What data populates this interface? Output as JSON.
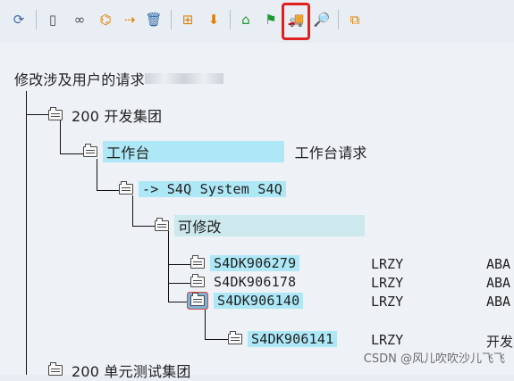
{
  "toolbar": {
    "icons": [
      {
        "name": "refresh-icon",
        "glyph": "⟳",
        "color": "#3b6aa6"
      },
      {
        "name": "new-document-icon",
        "glyph": "▯",
        "color": "#4c4c4c"
      },
      {
        "name": "glasses-icon",
        "glyph": "∞",
        "color": "#4c4c4c"
      },
      {
        "name": "hierarchy-icon",
        "glyph": "⌬",
        "color": "#e08000"
      },
      {
        "name": "forward-arrow-icon",
        "glyph": "⇢",
        "color": "#e08000"
      },
      {
        "name": "trash-icon",
        "glyph": "🗑",
        "color": "#2f68a6"
      },
      {
        "name": "structure-icon",
        "glyph": "⊞",
        "color": "#e08000"
      },
      {
        "name": "release-icon",
        "glyph": "⬇",
        "color": "#e08000"
      },
      {
        "name": "tree-icon",
        "glyph": "⌂",
        "color": "#1d9a31"
      },
      {
        "name": "flag-icon",
        "glyph": "⚑",
        "color": "#1d9a31"
      },
      {
        "name": "truck-icon",
        "glyph": "🚚",
        "color": "#e08000"
      },
      {
        "name": "search-doc-icon",
        "glyph": "🔎",
        "color": "#4c4c4c"
      },
      {
        "name": "copy-icon",
        "glyph": "⧉",
        "color": "#e08000"
      }
    ]
  },
  "tree": {
    "root_label": "修改涉及用户的请求",
    "nodes": {
      "client_200": {
        "label": "200 开发集团"
      },
      "workbench": {
        "label": "工作台",
        "desc": "工作台请求"
      },
      "system": {
        "label": "-> S4Q System S4Q"
      },
      "modifiable": {
        "label": "可修改"
      },
      "req1": {
        "id": "S4DK906279",
        "owner": "LRZY",
        "desc": "ABA"
      },
      "req2": {
        "id": "S4DK906178",
        "owner": "LRZY",
        "desc": "ABA"
      },
      "req3": {
        "id": "S4DK906140",
        "owner": "LRZY",
        "desc": "ABA"
      },
      "task1": {
        "id": "S4DK906141",
        "owner": "LRZY",
        "desc": "开发"
      },
      "client_next": {
        "label": "200 单元测试集团"
      }
    }
  },
  "watermark": "CSDN @风儿吹吹沙儿飞飞"
}
